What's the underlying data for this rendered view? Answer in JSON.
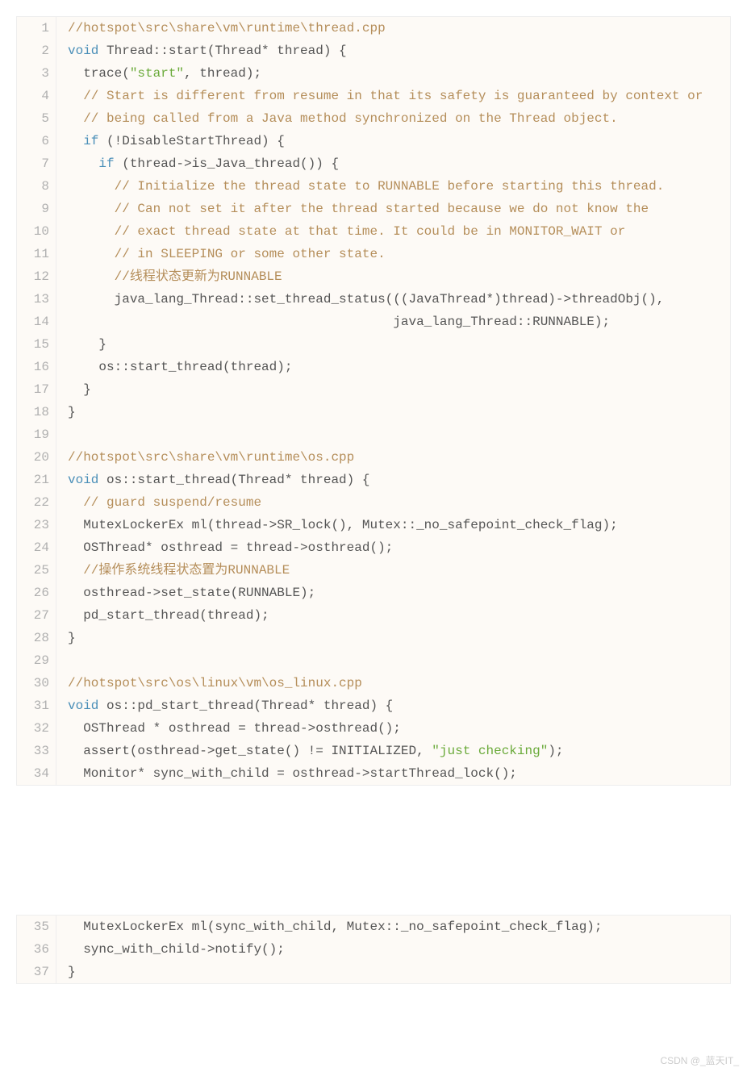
{
  "watermark": "CSDN @_蓝天IT_",
  "block1": {
    "start": 1,
    "lines": [
      [
        {
          "cls": "c-comment",
          "text": "//hotspot\\src\\share\\vm\\runtime\\thread.cpp"
        }
      ],
      [
        {
          "cls": "c-keyword",
          "text": "void"
        },
        {
          "cls": "c-plain",
          "text": " Thread::start(Thread* thread) {"
        }
      ],
      [
        {
          "cls": "c-plain",
          "text": "  trace("
        },
        {
          "cls": "c-string",
          "text": "\"start\""
        },
        {
          "cls": "c-plain",
          "text": ", thread);"
        }
      ],
      [
        {
          "cls": "c-plain",
          "text": "  "
        },
        {
          "cls": "c-comment",
          "text": "// Start is different from resume in that its safety is guaranteed by context or"
        }
      ],
      [
        {
          "cls": "c-plain",
          "text": "  "
        },
        {
          "cls": "c-comment",
          "text": "// being called from a Java method synchronized on the Thread object."
        }
      ],
      [
        {
          "cls": "c-plain",
          "text": "  "
        },
        {
          "cls": "c-keyword",
          "text": "if"
        },
        {
          "cls": "c-plain",
          "text": " (!DisableStartThread) {"
        }
      ],
      [
        {
          "cls": "c-plain",
          "text": "    "
        },
        {
          "cls": "c-keyword",
          "text": "if"
        },
        {
          "cls": "c-plain",
          "text": " (thread->is_Java_thread()) {"
        }
      ],
      [
        {
          "cls": "c-plain",
          "text": "      "
        },
        {
          "cls": "c-comment",
          "text": "// Initialize the thread state to RUNNABLE before starting this thread."
        }
      ],
      [
        {
          "cls": "c-plain",
          "text": "      "
        },
        {
          "cls": "c-comment",
          "text": "// Can not set it after the thread started because we do not know the"
        }
      ],
      [
        {
          "cls": "c-plain",
          "text": "      "
        },
        {
          "cls": "c-comment",
          "text": "// exact thread state at that time. It could be in MONITOR_WAIT or"
        }
      ],
      [
        {
          "cls": "c-plain",
          "text": "      "
        },
        {
          "cls": "c-comment",
          "text": "// in SLEEPING or some other state."
        }
      ],
      [
        {
          "cls": "c-plain",
          "text": "      "
        },
        {
          "cls": "c-comment",
          "text": "//线程状态更新为RUNNABLE"
        }
      ],
      [
        {
          "cls": "c-plain",
          "text": "      java_lang_Thread::set_thread_status(((JavaThread*)thread)->threadObj(),"
        }
      ],
      [
        {
          "cls": "c-plain",
          "text": "                                          java_lang_Thread::RUNNABLE);"
        }
      ],
      [
        {
          "cls": "c-plain",
          "text": "    }"
        }
      ],
      [
        {
          "cls": "c-plain",
          "text": "    os::start_thread(thread);"
        }
      ],
      [
        {
          "cls": "c-plain",
          "text": "  }"
        }
      ],
      [
        {
          "cls": "c-plain",
          "text": "}"
        }
      ],
      [
        {
          "cls": "c-plain",
          "text": ""
        }
      ],
      [
        {
          "cls": "c-comment",
          "text": "//hotspot\\src\\share\\vm\\runtime\\os.cpp"
        }
      ],
      [
        {
          "cls": "c-keyword",
          "text": "void"
        },
        {
          "cls": "c-plain",
          "text": " os::start_thread(Thread* thread) {"
        }
      ],
      [
        {
          "cls": "c-plain",
          "text": "  "
        },
        {
          "cls": "c-comment",
          "text": "// guard suspend/resume"
        }
      ],
      [
        {
          "cls": "c-plain",
          "text": "  MutexLockerEx ml(thread->SR_lock(), Mutex::_no_safepoint_check_flag);"
        }
      ],
      [
        {
          "cls": "c-plain",
          "text": "  OSThread* osthread = thread->osthread();"
        }
      ],
      [
        {
          "cls": "c-plain",
          "text": "  "
        },
        {
          "cls": "c-comment",
          "text": "//操作系统线程状态置为RUNNABLE"
        }
      ],
      [
        {
          "cls": "c-plain",
          "text": "  osthread->set_state(RUNNABLE);"
        }
      ],
      [
        {
          "cls": "c-plain",
          "text": "  pd_start_thread(thread);"
        }
      ],
      [
        {
          "cls": "c-plain",
          "text": "}"
        }
      ],
      [
        {
          "cls": "c-plain",
          "text": ""
        }
      ],
      [
        {
          "cls": "c-comment",
          "text": "//hotspot\\src\\os\\linux\\vm\\os_linux.cpp"
        }
      ],
      [
        {
          "cls": "c-keyword",
          "text": "void"
        },
        {
          "cls": "c-plain",
          "text": " os::pd_start_thread(Thread* thread) {"
        }
      ],
      [
        {
          "cls": "c-plain",
          "text": "  OSThread * osthread = thread->osthread();"
        }
      ],
      [
        {
          "cls": "c-plain",
          "text": "  assert(osthread->get_state() != INITIALIZED, "
        },
        {
          "cls": "c-string",
          "text": "\"just checking\""
        },
        {
          "cls": "c-plain",
          "text": ");"
        }
      ],
      [
        {
          "cls": "c-plain",
          "text": "  Monitor* sync_with_child = osthread->startThread_lock();"
        }
      ]
    ]
  },
  "block2": {
    "start": 35,
    "lines": [
      [
        {
          "cls": "c-plain",
          "text": "  MutexLockerEx ml(sync_with_child, Mutex::_no_safepoint_check_flag);"
        }
      ],
      [
        {
          "cls": "c-plain",
          "text": "  sync_with_child->notify();"
        }
      ],
      [
        {
          "cls": "c-plain",
          "text": "}"
        }
      ]
    ]
  }
}
